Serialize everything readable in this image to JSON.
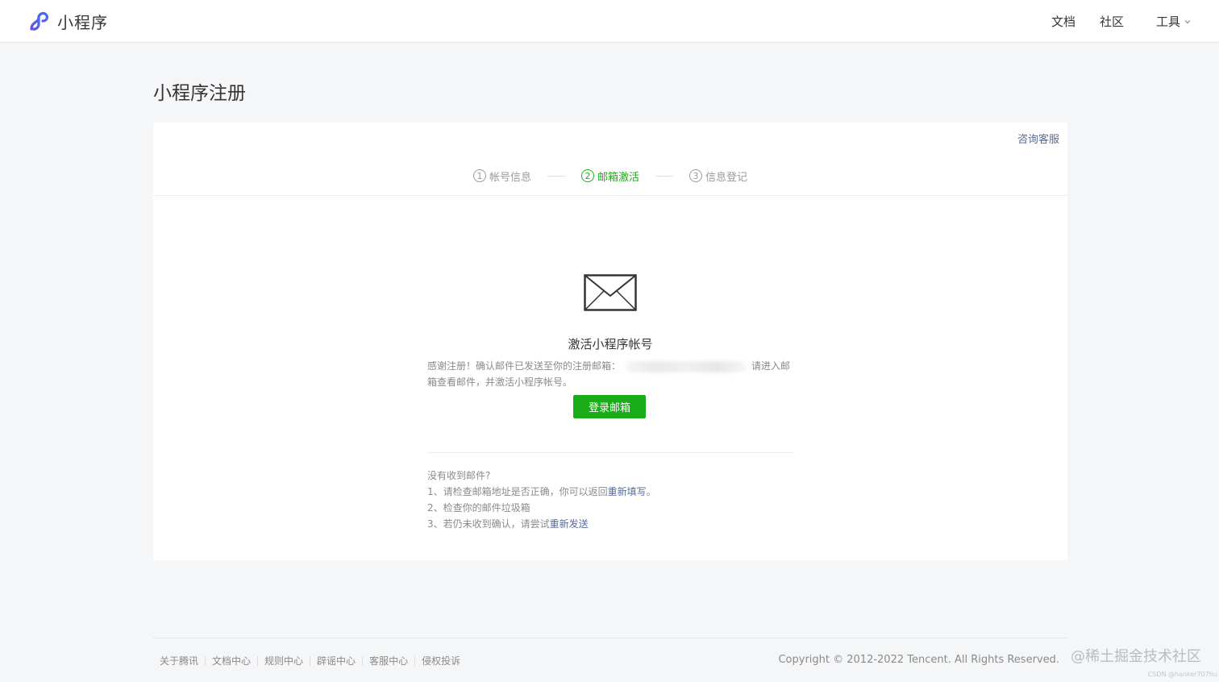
{
  "header": {
    "brand_name": "小程序",
    "nav": {
      "docs": "文档",
      "community": "社区",
      "tools": "工具"
    }
  },
  "page_title": "小程序注册",
  "card": {
    "consult_link": "咨询客服",
    "steps": [
      {
        "num": "1",
        "label": "帐号信息",
        "active": false
      },
      {
        "num": "2",
        "label": "邮箱激活",
        "active": true
      },
      {
        "num": "3",
        "label": "信息登记",
        "active": false
      }
    ],
    "activate_title": "激活小程序帐号",
    "desc_prefix": "感谢注册！确认邮件已发送至你的注册邮箱：",
    "desc_suffix": "请进入邮箱查看邮件，并激活小程序帐号。",
    "login_button": "登录邮箱",
    "tips": {
      "heading": "没有收到邮件?",
      "line1_prefix": "1、请检查邮箱地址是否正确，你可以返回",
      "line1_link": "重新填写",
      "line1_suffix": "。",
      "line2": "2、检查你的邮件垃圾箱",
      "line3_prefix": "3、若仍未收到确认，请尝试",
      "line3_link": "重新发送"
    }
  },
  "footer": {
    "links": [
      "关于腾讯",
      "文档中心",
      "规则中心",
      "辟谣中心",
      "客服中心",
      "侵权投诉"
    ],
    "copyright": "Copyright © 2012-2022 Tencent. All Rights Reserved."
  },
  "watermark": {
    "main": "@稀土掘金技术社区",
    "small": "CSDN @hanker707hu"
  },
  "colors": {
    "accent_green": "#1aad19",
    "link_blue": "#576b95",
    "brand_purple": "#6467f0"
  }
}
